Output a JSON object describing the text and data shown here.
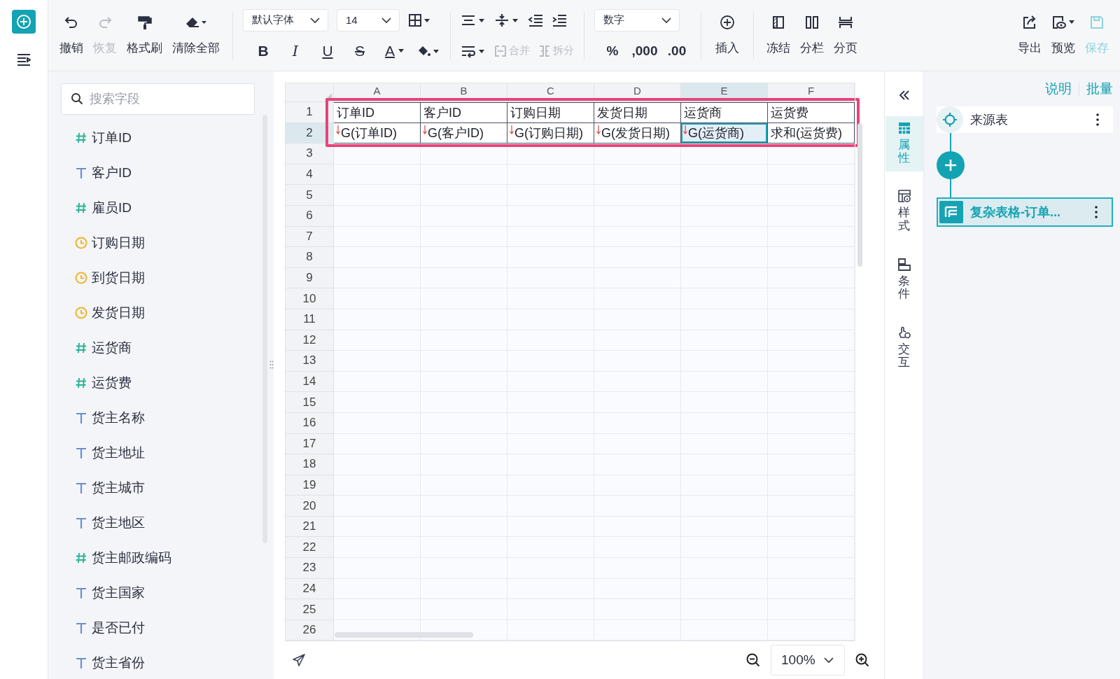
{
  "toolbar": {
    "history": [
      {
        "label": "撤销",
        "kind": "undo",
        "disabled": false
      },
      {
        "label": "恢复",
        "kind": "redo",
        "disabled": true
      },
      {
        "label": "格式刷",
        "kind": "brush",
        "disabled": false
      },
      {
        "label": "清除全部",
        "kind": "eraser",
        "disabled": false
      }
    ],
    "font": {
      "value": "默认字体"
    },
    "size": {
      "value": "14"
    },
    "text_styles": [
      {
        "glyph": "B",
        "kind": "bold"
      },
      {
        "glyph": "I",
        "kind": "italic"
      },
      {
        "glyph": "U",
        "kind": "underline"
      },
      {
        "glyph": "S",
        "kind": "strike"
      },
      {
        "glyph": "A",
        "kind": "color"
      }
    ],
    "merge": {
      "label": "合并",
      "disabled": true
    },
    "split": {
      "label": "拆分",
      "disabled": true
    },
    "number_format": {
      "value": "数字"
    },
    "number_buttons": [
      "%",
      ",000",
      ".00"
    ],
    "insert": {
      "label": "插入"
    },
    "layout": [
      {
        "label": "冻结",
        "kind": "freeze"
      },
      {
        "label": "分栏",
        "kind": "columns"
      },
      {
        "label": "分页",
        "kind": "page"
      }
    ],
    "output": [
      {
        "label": "导出",
        "kind": "export",
        "disabled": false
      },
      {
        "label": "预览",
        "kind": "preview",
        "disabled": false
      },
      {
        "label": "保存",
        "kind": "save",
        "disabled": true
      }
    ]
  },
  "fields": {
    "placeholder": "搜索字段",
    "items": [
      {
        "name": "订单ID",
        "kind": "number"
      },
      {
        "name": "客户ID",
        "kind": "text"
      },
      {
        "name": "雇员ID",
        "kind": "number"
      },
      {
        "name": "订购日期",
        "kind": "date"
      },
      {
        "name": "到货日期",
        "kind": "date"
      },
      {
        "name": "发货日期",
        "kind": "date"
      },
      {
        "name": "运货商",
        "kind": "number"
      },
      {
        "name": "运货费",
        "kind": "number"
      },
      {
        "name": "货主名称",
        "kind": "text"
      },
      {
        "name": "货主地址",
        "kind": "text"
      },
      {
        "name": "货主城市",
        "kind": "text"
      },
      {
        "name": "货主地区",
        "kind": "text"
      },
      {
        "name": "货主邮政编码",
        "kind": "number"
      },
      {
        "name": "货主国家",
        "kind": "text"
      },
      {
        "name": "是否已付",
        "kind": "text"
      },
      {
        "name": "货主省份",
        "kind": "text"
      }
    ]
  },
  "sheet": {
    "columns": [
      {
        "label": "A",
        "selected": false
      },
      {
        "label": "B",
        "selected": false
      },
      {
        "label": "C",
        "selected": false
      },
      {
        "label": "D",
        "selected": false
      },
      {
        "label": "E",
        "selected": true
      },
      {
        "label": "F",
        "selected": false
      }
    ],
    "rows": [
      {
        "label": "1",
        "selected": false,
        "cells": [
          {
            "text": "订单ID",
            "expand": false,
            "selected": false
          },
          {
            "text": "客户ID",
            "expand": false,
            "selected": false
          },
          {
            "text": "订购日期",
            "expand": false,
            "selected": false
          },
          {
            "text": "发货日期",
            "expand": false,
            "selected": false
          },
          {
            "text": "运货商",
            "expand": false,
            "selected": false
          },
          {
            "text": "运货费",
            "expand": false,
            "selected": false
          }
        ]
      },
      {
        "label": "2",
        "selected": true,
        "cells": [
          {
            "text": "G(订单ID)",
            "expand": true,
            "selected": false
          },
          {
            "text": "G(客户ID)",
            "expand": true,
            "selected": false
          },
          {
            "text": "G(订购日期)",
            "expand": true,
            "selected": false
          },
          {
            "text": "G(发货日期)",
            "expand": true,
            "selected": false
          },
          {
            "text": "G(运货商)",
            "expand": true,
            "selected": true
          },
          {
            "text": "求和(运货费)",
            "expand": false,
            "selected": false
          }
        ]
      },
      {
        "label": "3",
        "selected": false
      },
      {
        "label": "4",
        "selected": false
      },
      {
        "label": "5",
        "selected": false
      },
      {
        "label": "6",
        "selected": false
      },
      {
        "label": "7",
        "selected": false
      },
      {
        "label": "8",
        "selected": false
      },
      {
        "label": "9",
        "selected": false
      },
      {
        "label": "10",
        "selected": false
      },
      {
        "label": "11",
        "selected": false
      },
      {
        "label": "12",
        "selected": false
      },
      {
        "label": "13",
        "selected": false
      },
      {
        "label": "14",
        "selected": false
      },
      {
        "label": "15",
        "selected": false
      },
      {
        "label": "16",
        "selected": false
      },
      {
        "label": "17",
        "selected": false
      },
      {
        "label": "18",
        "selected": false
      },
      {
        "label": "19",
        "selected": false
      },
      {
        "label": "20",
        "selected": false
      },
      {
        "label": "21",
        "selected": false
      },
      {
        "label": "22",
        "selected": false
      },
      {
        "label": "23",
        "selected": false
      },
      {
        "label": "24",
        "selected": false
      },
      {
        "label": "25",
        "selected": false
      },
      {
        "label": "26",
        "selected": false
      }
    ],
    "zoom": "100%"
  },
  "side_tabs": [
    {
      "label": "属性",
      "kind": "props",
      "selected": true
    },
    {
      "label": "样式",
      "kind": "style",
      "selected": false
    },
    {
      "label": "条件",
      "kind": "condition",
      "selected": false
    },
    {
      "label": "交互",
      "kind": "interaction",
      "selected": false
    }
  ],
  "panel": {
    "links": [
      "说明",
      "批量"
    ],
    "nodes": [
      {
        "label": "来源表",
        "kind": "source",
        "selected": false
      },
      {
        "label": "复杂表格-订单...",
        "kind": "table",
        "selected": true
      }
    ]
  }
}
